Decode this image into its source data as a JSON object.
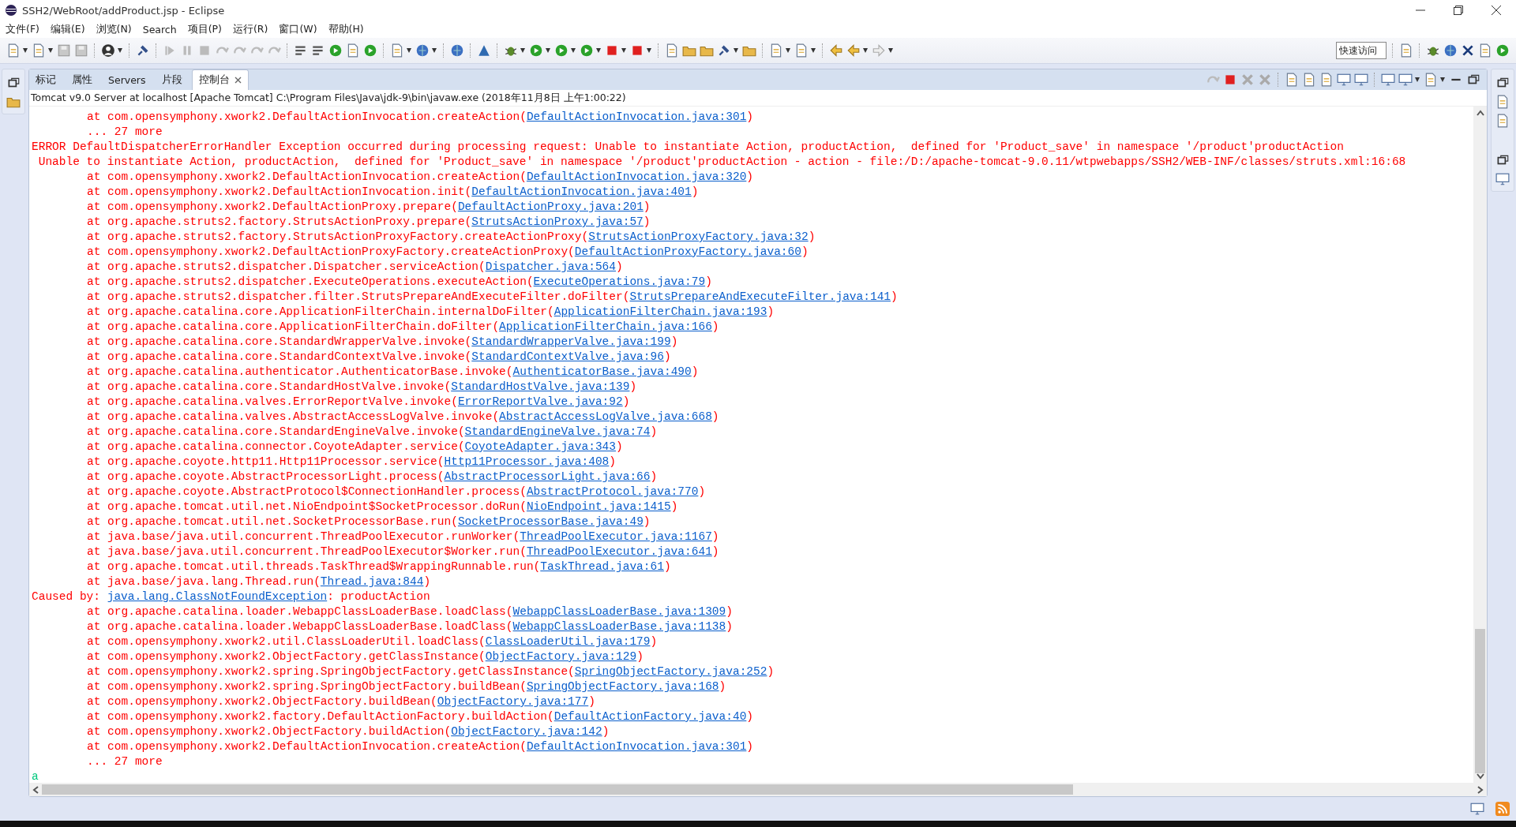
{
  "window": {
    "title": "SSH2/WebRoot/addProduct.jsp - Eclipse"
  },
  "menu": [
    "文件(F)",
    "编辑(E)",
    "浏览(N)",
    "Search",
    "项目(P)",
    "运行(R)",
    "窗口(W)",
    "帮助(H)"
  ],
  "quick_access": {
    "placeholder": "快速访问"
  },
  "tabs": [
    {
      "label": "标记",
      "selected": false,
      "closable": false
    },
    {
      "label": "属性",
      "selected": false,
      "closable": false
    },
    {
      "label": "Servers",
      "selected": false,
      "closable": false
    },
    {
      "label": "片段",
      "selected": false,
      "closable": false
    },
    {
      "label": "控制台",
      "selected": true,
      "closable": true
    }
  ],
  "console": {
    "header": "Tomcat v9.0 Server at localhost [Apache Tomcat] C:\\Program Files\\Java\\jdk-9\\bin\\javaw.exe  (2018年11月8日 上午1:00:22)",
    "lines": [
      {
        "kind": "frame",
        "text": "at com.opensymphony.xwork2.DefaultActionInvocation.createAction(",
        "link": "DefaultActionInvocation.java:301",
        "tail": ")"
      },
      {
        "kind": "frame",
        "text": "... 27 more"
      },
      {
        "kind": "message",
        "text": "ERROR DefaultDispatcherErrorHandler Exception occurred during processing request: Unable to instantiate Action, productAction,  defined for 'Product_save' in namespace '/product'productAction"
      },
      {
        "kind": "message",
        "text": " Unable to instantiate Action, productAction,  defined for 'Product_save' in namespace '/product'productAction - action - file:/D:/apache-tomcat-9.0.11/wtpwebapps/SSH2/WEB-INF/classes/struts.xml:16:68"
      },
      {
        "kind": "frame",
        "text": "at com.opensymphony.xwork2.DefaultActionInvocation.createAction(",
        "link": "DefaultActionInvocation.java:320",
        "tail": ")"
      },
      {
        "kind": "frame",
        "text": "at com.opensymphony.xwork2.DefaultActionInvocation.init(",
        "link": "DefaultActionInvocation.java:401",
        "tail": ")"
      },
      {
        "kind": "frame",
        "text": "at com.opensymphony.xwork2.DefaultActionProxy.prepare(",
        "link": "DefaultActionProxy.java:201",
        "tail": ")"
      },
      {
        "kind": "frame",
        "text": "at org.apache.struts2.factory.StrutsActionProxy.prepare(",
        "link": "StrutsActionProxy.java:57",
        "tail": ")"
      },
      {
        "kind": "frame",
        "text": "at org.apache.struts2.factory.StrutsActionProxyFactory.createActionProxy(",
        "link": "StrutsActionProxyFactory.java:32",
        "tail": ")"
      },
      {
        "kind": "frame",
        "text": "at com.opensymphony.xwork2.DefaultActionProxyFactory.createActionProxy(",
        "link": "DefaultActionProxyFactory.java:60",
        "tail": ")"
      },
      {
        "kind": "frame",
        "text": "at org.apache.struts2.dispatcher.Dispatcher.serviceAction(",
        "link": "Dispatcher.java:564",
        "tail": ")"
      },
      {
        "kind": "frame",
        "text": "at org.apache.struts2.dispatcher.ExecuteOperations.executeAction(",
        "link": "ExecuteOperations.java:79",
        "tail": ")"
      },
      {
        "kind": "frame",
        "text": "at org.apache.struts2.dispatcher.filter.StrutsPrepareAndExecuteFilter.doFilter(",
        "link": "StrutsPrepareAndExecuteFilter.java:141",
        "tail": ")"
      },
      {
        "kind": "frame",
        "text": "at org.apache.catalina.core.ApplicationFilterChain.internalDoFilter(",
        "link": "ApplicationFilterChain.java:193",
        "tail": ")"
      },
      {
        "kind": "frame",
        "text": "at org.apache.catalina.core.ApplicationFilterChain.doFilter(",
        "link": "ApplicationFilterChain.java:166",
        "tail": ")"
      },
      {
        "kind": "frame",
        "text": "at org.apache.catalina.core.StandardWrapperValve.invoke(",
        "link": "StandardWrapperValve.java:199",
        "tail": ")"
      },
      {
        "kind": "frame",
        "text": "at org.apache.catalina.core.StandardContextValve.invoke(",
        "link": "StandardContextValve.java:96",
        "tail": ")"
      },
      {
        "kind": "frame",
        "text": "at org.apache.catalina.authenticator.AuthenticatorBase.invoke(",
        "link": "AuthenticatorBase.java:490",
        "tail": ")"
      },
      {
        "kind": "frame",
        "text": "at org.apache.catalina.core.StandardHostValve.invoke(",
        "link": "StandardHostValve.java:139",
        "tail": ")"
      },
      {
        "kind": "frame",
        "text": "at org.apache.catalina.valves.ErrorReportValve.invoke(",
        "link": "ErrorReportValve.java:92",
        "tail": ")"
      },
      {
        "kind": "frame",
        "text": "at org.apache.catalina.valves.AbstractAccessLogValve.invoke(",
        "link": "AbstractAccessLogValve.java:668",
        "tail": ")"
      },
      {
        "kind": "frame",
        "text": "at org.apache.catalina.core.StandardEngineValve.invoke(",
        "link": "StandardEngineValve.java:74",
        "tail": ")"
      },
      {
        "kind": "frame",
        "text": "at org.apache.catalina.connector.CoyoteAdapter.service(",
        "link": "CoyoteAdapter.java:343",
        "tail": ")"
      },
      {
        "kind": "frame",
        "text": "at org.apache.coyote.http11.Http11Processor.service(",
        "link": "Http11Processor.java:408",
        "tail": ")"
      },
      {
        "kind": "frame",
        "text": "at org.apache.coyote.AbstractProcessorLight.process(",
        "link": "AbstractProcessorLight.java:66",
        "tail": ")"
      },
      {
        "kind": "frame",
        "text": "at org.apache.coyote.AbstractProtocol$ConnectionHandler.process(",
        "link": "AbstractProtocol.java:770",
        "tail": ")"
      },
      {
        "kind": "frame",
        "text": "at org.apache.tomcat.util.net.NioEndpoint$SocketProcessor.doRun(",
        "link": "NioEndpoint.java:1415",
        "tail": ")"
      },
      {
        "kind": "frame",
        "text": "at org.apache.tomcat.util.net.SocketProcessorBase.run(",
        "link": "SocketProcessorBase.java:49",
        "tail": ")"
      },
      {
        "kind": "frame",
        "text": "at java.base/java.util.concurrent.ThreadPoolExecutor.runWorker(",
        "link": "ThreadPoolExecutor.java:1167",
        "tail": ")"
      },
      {
        "kind": "frame",
        "text": "at java.base/java.util.concurrent.ThreadPoolExecutor$Worker.run(",
        "link": "ThreadPoolExecutor.java:641",
        "tail": ")"
      },
      {
        "kind": "frame",
        "text": "at org.apache.tomcat.util.threads.TaskThread$WrappingRunnable.run(",
        "link": "TaskThread.java:61",
        "tail": ")"
      },
      {
        "kind": "frame",
        "text": "at java.base/java.lang.Thread.run(",
        "link": "Thread.java:844",
        "tail": ")"
      },
      {
        "kind": "message",
        "text": "Caused by: ",
        "link": "java.lang.ClassNotFoundException",
        "tail": ": productAction"
      },
      {
        "kind": "frame",
        "text": "at org.apache.catalina.loader.WebappClassLoaderBase.loadClass(",
        "link": "WebappClassLoaderBase.java:1309",
        "tail": ")"
      },
      {
        "kind": "frame",
        "text": "at org.apache.catalina.loader.WebappClassLoaderBase.loadClass(",
        "link": "WebappClassLoaderBase.java:1138",
        "tail": ")"
      },
      {
        "kind": "frame",
        "text": "at com.opensymphony.xwork2.util.ClassLoaderUtil.loadClass(",
        "link": "ClassLoaderUtil.java:179",
        "tail": ")"
      },
      {
        "kind": "frame",
        "text": "at com.opensymphony.xwork2.ObjectFactory.getClassInstance(",
        "link": "ObjectFactory.java:129",
        "tail": ")"
      },
      {
        "kind": "frame",
        "text": "at com.opensymphony.xwork2.spring.SpringObjectFactory.getClassInstance(",
        "link": "SpringObjectFactory.java:252",
        "tail": ")"
      },
      {
        "kind": "frame",
        "text": "at com.opensymphony.xwork2.spring.SpringObjectFactory.buildBean(",
        "link": "SpringObjectFactory.java:168",
        "tail": ")"
      },
      {
        "kind": "frame",
        "text": "at com.opensymphony.xwork2.ObjectFactory.buildBean(",
        "link": "ObjectFactory.java:177",
        "tail": ")"
      },
      {
        "kind": "frame",
        "text": "at com.opensymphony.xwork2.factory.DefaultActionFactory.buildAction(",
        "link": "DefaultActionFactory.java:40",
        "tail": ")"
      },
      {
        "kind": "frame",
        "text": "at com.opensymphony.xwork2.ObjectFactory.buildAction(",
        "link": "ObjectFactory.java:142",
        "tail": ")"
      },
      {
        "kind": "frame",
        "text": "at com.opensymphony.xwork2.DefaultActionInvocation.createAction(",
        "link": "DefaultActionInvocation.java:301",
        "tail": ")"
      },
      {
        "kind": "frame",
        "text": "... 27 more"
      },
      {
        "kind": "input",
        "text": "a"
      }
    ]
  }
}
